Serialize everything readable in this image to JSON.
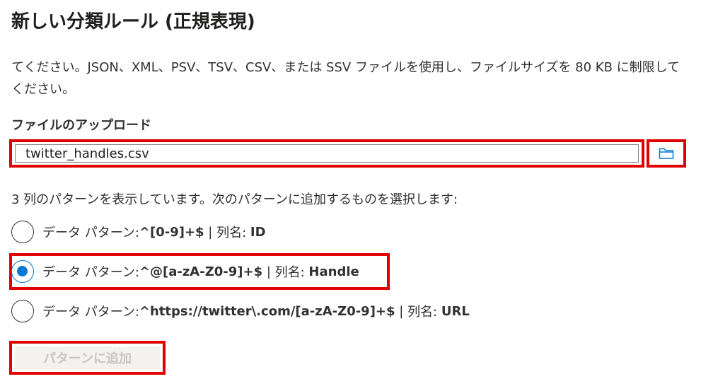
{
  "title": "新しい分類ルール (正規表現)",
  "description": "てください。JSON、XML、PSV、TSV、CSV、または SSV ファイルを使用し、ファイルサイズを 80 KB に制限してください。",
  "upload": {
    "label": "ファイルのアップロード",
    "file_name": "twitter_handles.csv",
    "browse_icon": "folder-icon"
  },
  "patterns_summary": "3 列のパターンを表示しています。次のパターンに追加するものを選択します:",
  "options": [
    {
      "prefix": "データ パターン:",
      "pattern": "^[0-9]+$",
      "separator": " | ",
      "column_label": "列名: ",
      "column": "ID",
      "selected": false
    },
    {
      "prefix": "データ パターン:",
      "pattern": "^@[a-zA-Z0-9]+$",
      "separator": " | ",
      "column_label": "列名: ",
      "column": "Handle",
      "selected": true
    },
    {
      "prefix": "データ パターン:",
      "pattern": "^https://twitter\\.com/[a-zA-Z0-9]+$",
      "separator": " | ",
      "column_label": "列名: ",
      "column": "URL",
      "selected": false
    }
  ],
  "add_button_label": "パターンに追加",
  "colors": {
    "highlight": "#e00000",
    "accent": "#0078d4",
    "disabled_text": "#c8c6c4"
  }
}
